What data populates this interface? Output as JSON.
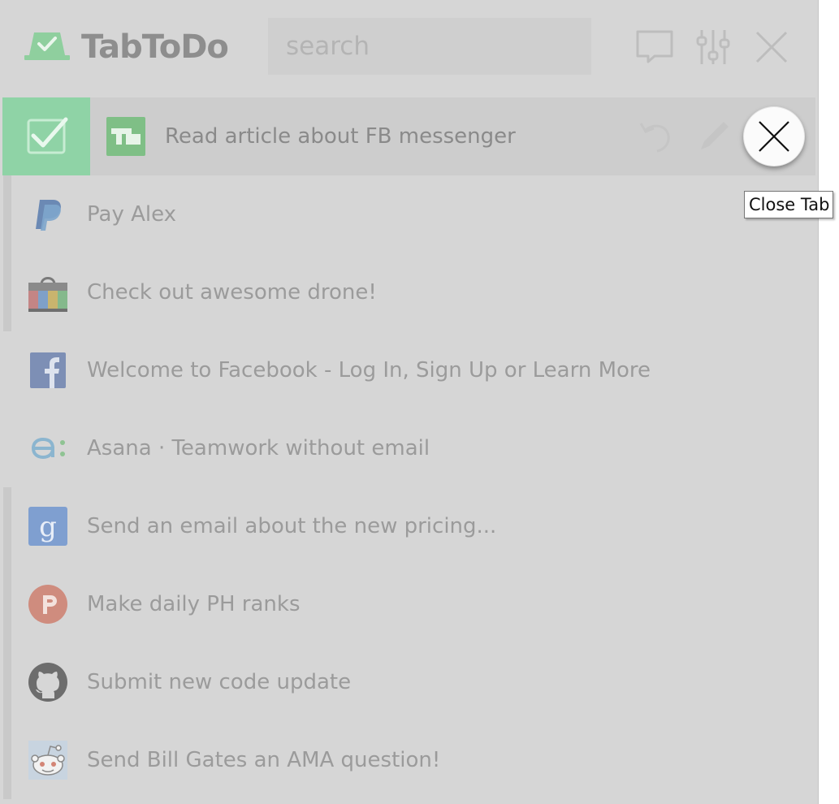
{
  "app": {
    "title": "TabToDo",
    "logo_icon": "tab-check-logo-icon",
    "accent_color": "#8fd3a6"
  },
  "search": {
    "placeholder": "search",
    "value": ""
  },
  "header_icons": [
    "chat-icon",
    "settings-sliders-icon",
    "close-icon"
  ],
  "active_item": {
    "title": "Read article about FB messenger",
    "favicon": "techcrunch-icon",
    "actions": [
      "undo-icon",
      "edit-icon"
    ]
  },
  "close_tab": {
    "tooltip": "Close Tab",
    "icon": "close-icon"
  },
  "items": [
    {
      "title": "Pay Alex",
      "favicon": "paypal-icon",
      "bar": true
    },
    {
      "title": "Check out awesome drone!",
      "favicon": "shopping-bag-icon",
      "bar": true
    },
    {
      "title": "Welcome to Facebook - Log In, Sign Up or Learn More",
      "favicon": "facebook-icon",
      "bar": false
    },
    {
      "title": "Asana · Teamwork without email",
      "favicon": "asana-icon",
      "bar": false
    },
    {
      "title": "Send an email about the new pricing...",
      "favicon": "google-icon",
      "bar": true
    },
    {
      "title": "Make daily PH ranks",
      "favicon": "producthunt-icon",
      "bar": true
    },
    {
      "title": "Submit new code update",
      "favicon": "github-icon",
      "bar": true
    },
    {
      "title": "Send Bill Gates an AMA question!",
      "favicon": "reddit-icon",
      "bar": true
    }
  ]
}
